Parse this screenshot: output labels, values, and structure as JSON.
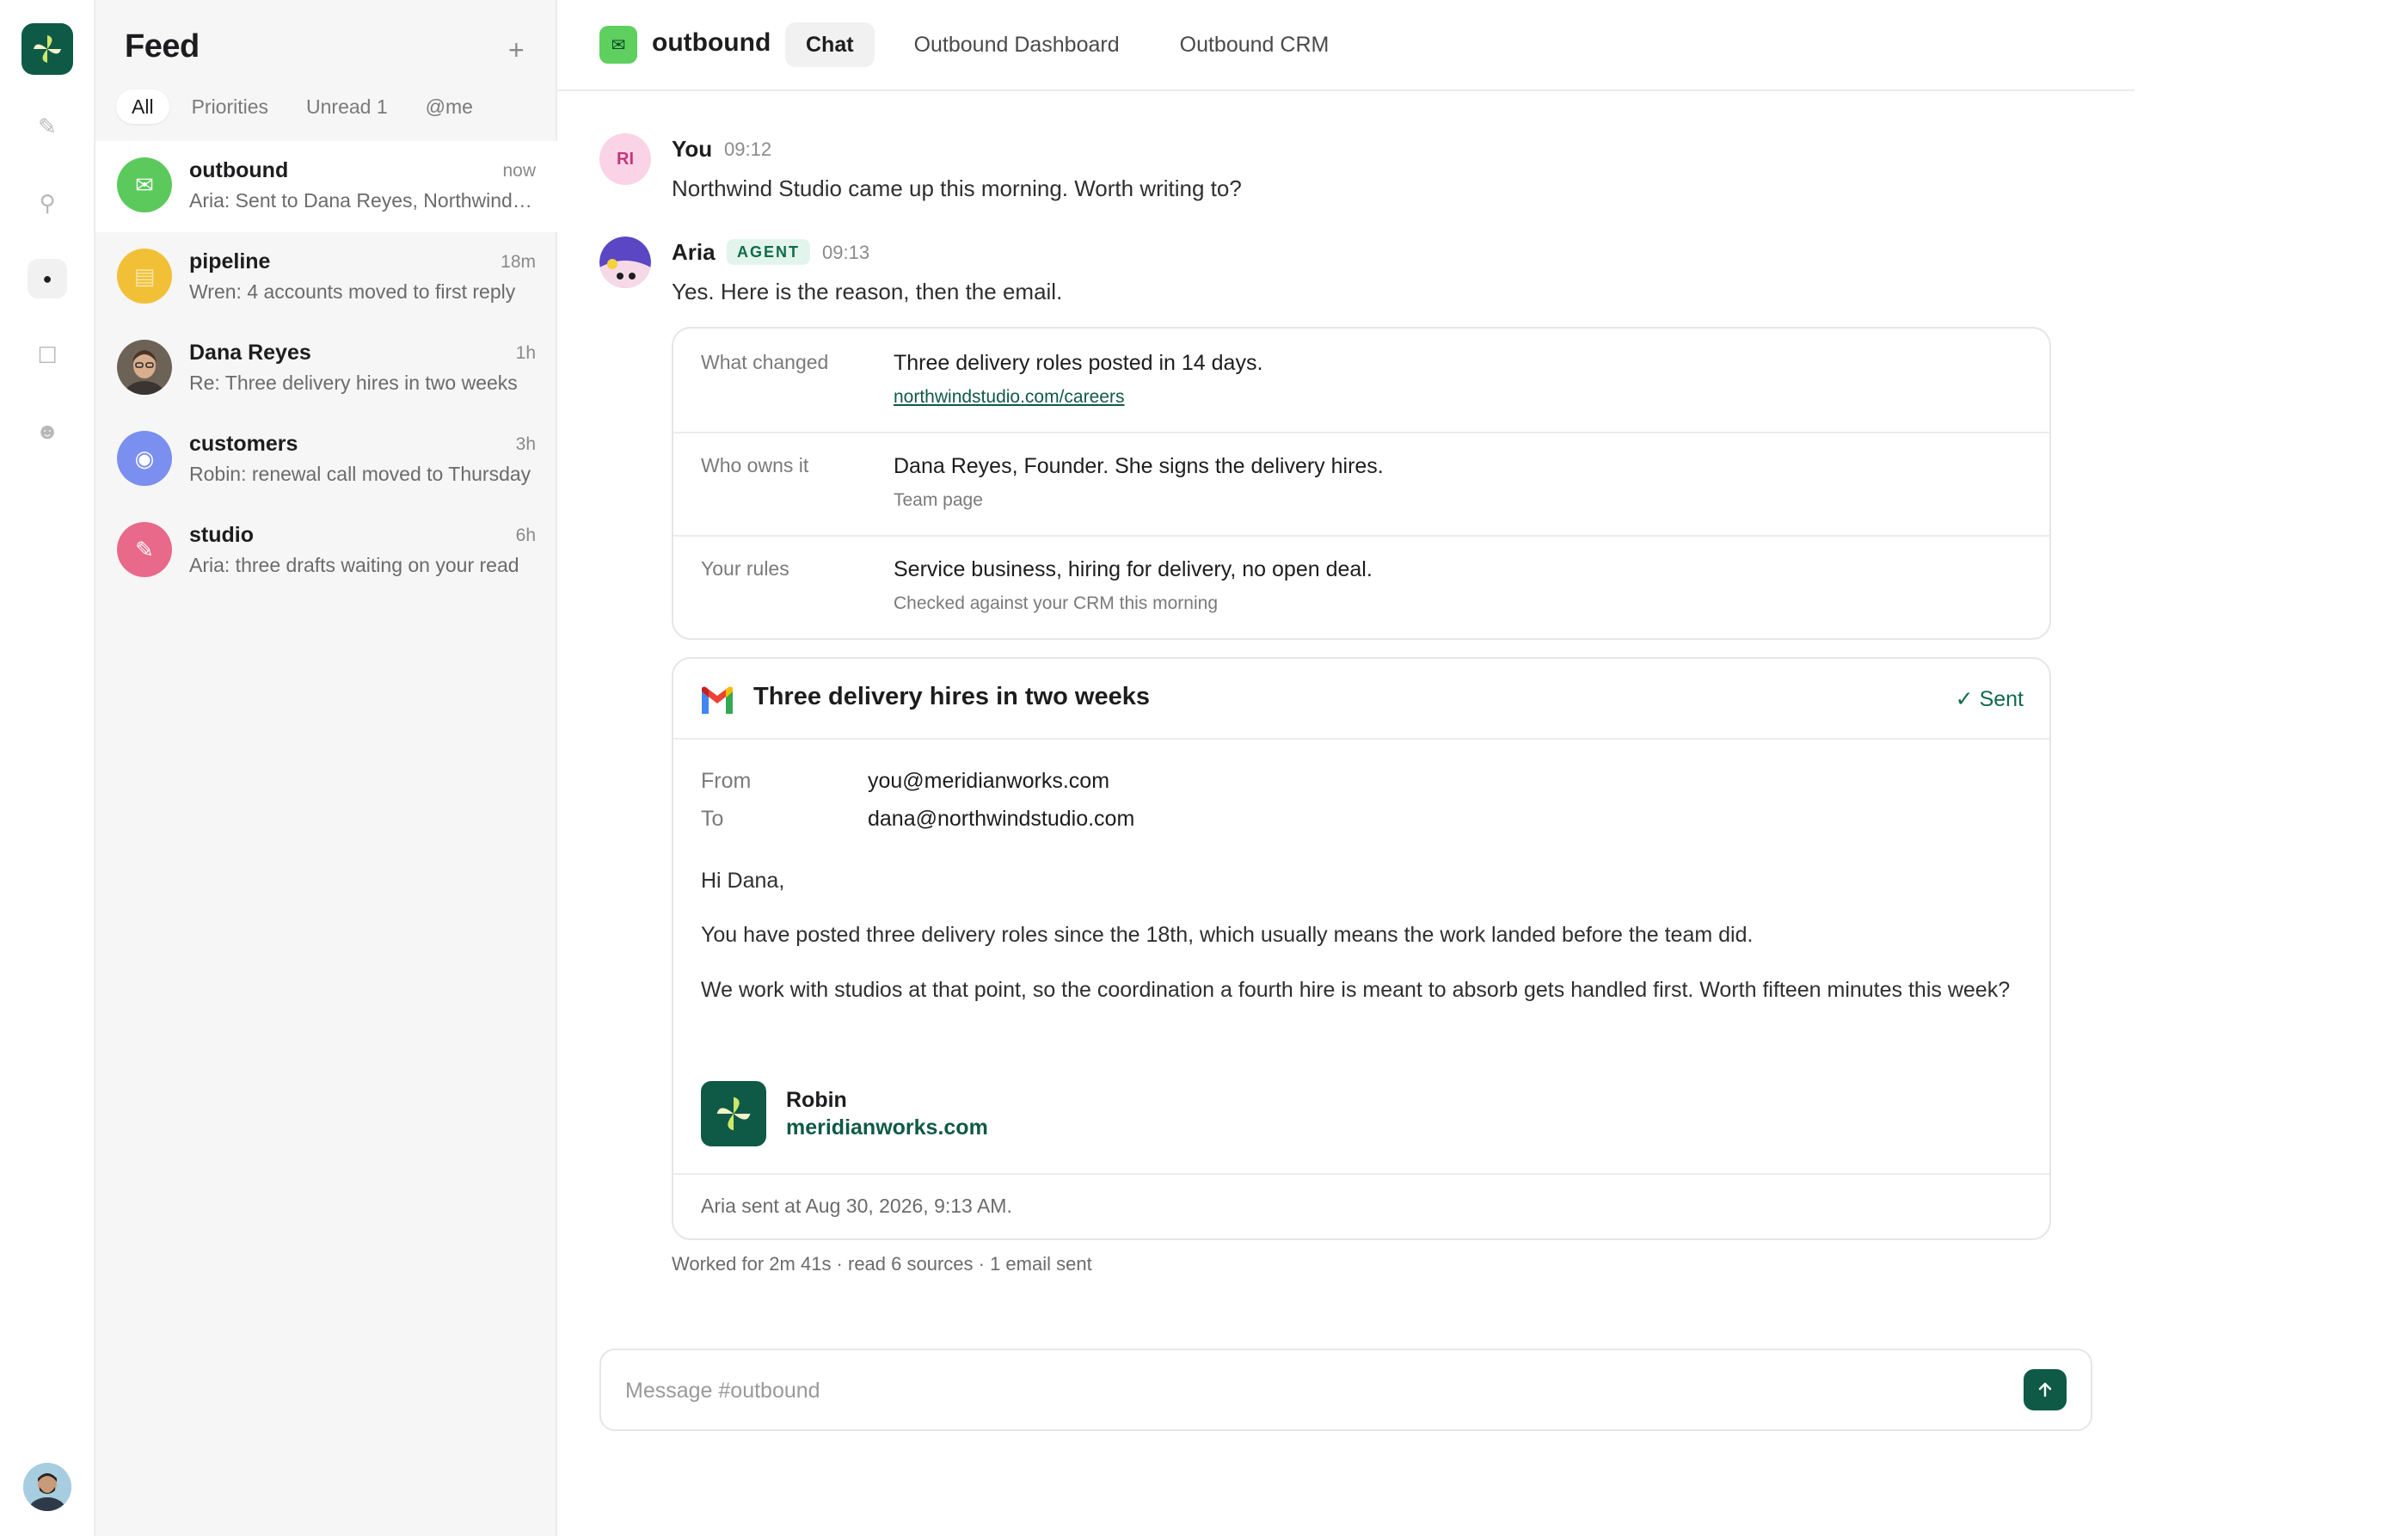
{
  "rail": {
    "icons": [
      "pencil-icon",
      "pin-icon",
      "dot-icon",
      "square-icon",
      "smiley-icon"
    ],
    "glyphs": [
      "✎",
      "⚲",
      "●",
      "☐",
      "☻"
    ]
  },
  "feed": {
    "title": "Feed",
    "add_glyph": "+",
    "filters": [
      "All",
      "Priorities",
      "Unread 1",
      "@me"
    ],
    "items": [
      {
        "name": "outbound",
        "time": "now",
        "preview": "Aria: Sent to Dana Reyes, Northwind Studio",
        "glyph": "✉",
        "color": "#5cc95c"
      },
      {
        "name": "pipeline",
        "time": "18m",
        "preview": "Wren: 4 accounts moved to first reply",
        "glyph": "▤",
        "color": "#f2c037"
      },
      {
        "name": "Dana Reyes",
        "time": "1h",
        "preview": "Re: Three delivery hires in two weeks",
        "glyph": "",
        "color": "#7a6a58"
      },
      {
        "name": "customers",
        "time": "3h",
        "preview": "Robin: renewal call moved to Thursday",
        "glyph": "◉",
        "color": "#7b8ff0"
      },
      {
        "name": "studio",
        "time": "6h",
        "preview": "Aria: three drafts waiting on your read",
        "glyph": "✎",
        "color": "#e8698a"
      }
    ]
  },
  "header": {
    "channel_glyph": "✉",
    "channel": "outbound",
    "tabs": [
      "Chat",
      "Outbound Dashboard",
      "Outbound CRM"
    ]
  },
  "messages": {
    "you": {
      "initials": "RI",
      "name": "You",
      "time": "09:12",
      "text": "Northwind Studio came up this morning. Worth writing to?"
    },
    "aria": {
      "name": "Aria",
      "badge": "AGENT",
      "time": "09:13",
      "text": "Yes. Here is the reason, then the email."
    }
  },
  "reason": [
    {
      "label": "What changed",
      "value": "Three delivery roles posted in 14 days.",
      "link": "northwindstudio.com/careers"
    },
    {
      "label": "Who owns it",
      "value": "Dana Reyes, Founder. She signs the delivery hires.",
      "sub": "Team page"
    },
    {
      "label": "Your rules",
      "value": "Service business, hiring for delivery, no open deal.",
      "sub": "Checked against your CRM this morning"
    }
  ],
  "email": {
    "title": "Three delivery hires in two weeks",
    "status": "✓ Sent",
    "from_label": "From",
    "from": "you@meridianworks.com",
    "to_label": "To",
    "to": "dana@northwindstudio.com",
    "greeting": "Hi Dana,",
    "p1": "You have posted three delivery roles since the 18th, which usually means the work landed before the team did.",
    "p2": "We work with studios at that point, so the coordination a fourth hire is meant to absorb gets handled first. Worth fifteen minutes this week?",
    "sig_name": "Robin",
    "sig_site": "meridianworks.com",
    "footer": "Aria sent at Aug 30, 2026, 9:13 AM."
  },
  "worked": "Worked for 2m 41s · read 6 sources · 1 email sent",
  "composer": {
    "placeholder": "Message #outbound"
  },
  "colors": {
    "brand": "#0f5a46",
    "agent_badge_bg": "#e3f4ec",
    "channel_icon": "#5fcf5f"
  }
}
